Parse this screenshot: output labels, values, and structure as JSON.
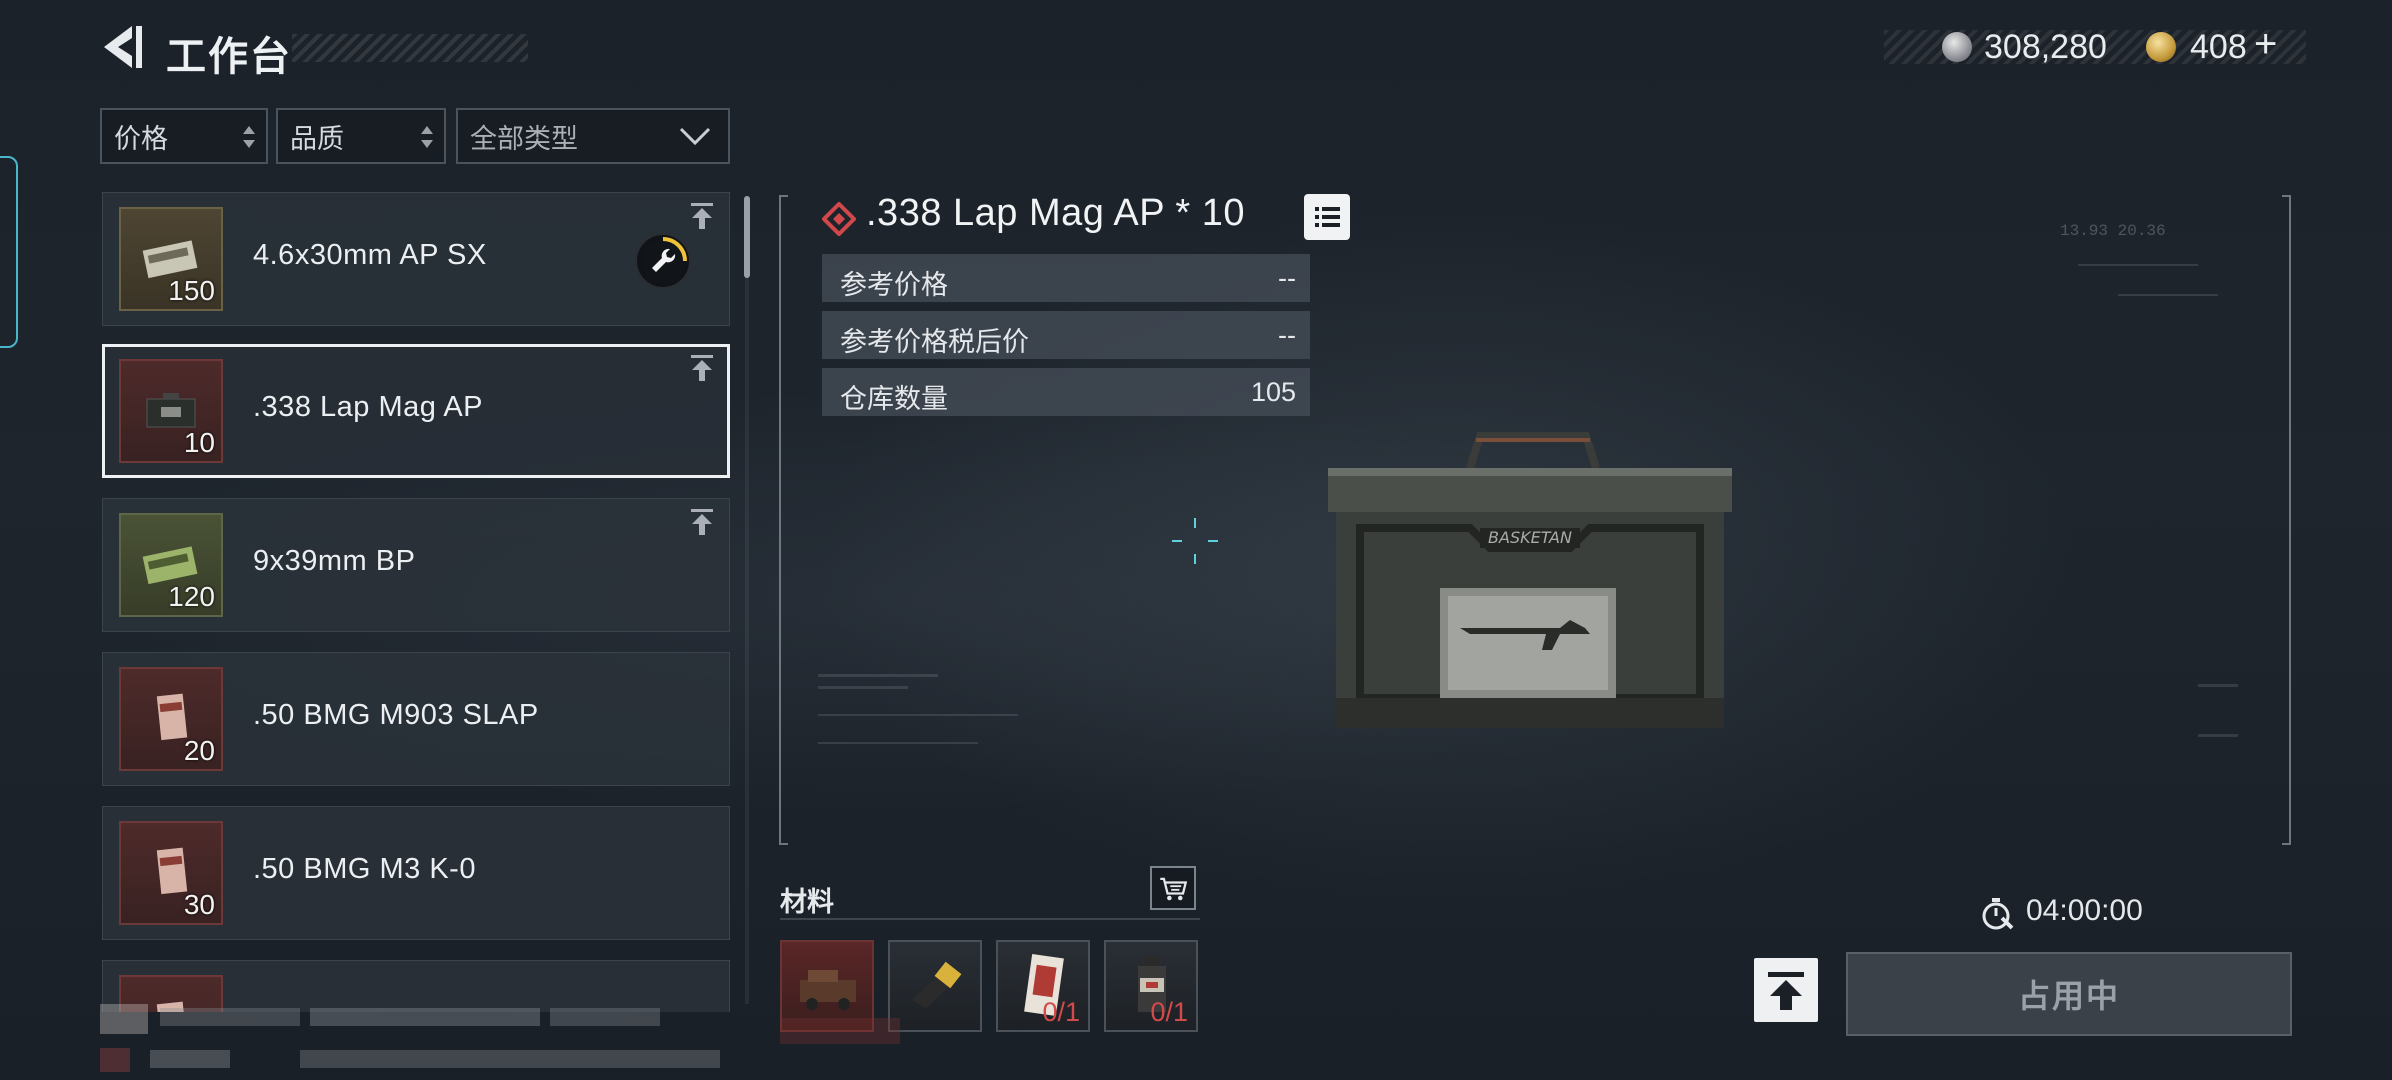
{
  "header": {
    "title": "工作台"
  },
  "currency": {
    "silver": "308,280",
    "gold": "408",
    "plus": "+",
    "silver_icon": "silver-coin-icon",
    "gold_icon": "gold-coin-icon"
  },
  "filters": {
    "price": "价格",
    "quality": "品质",
    "type": "全部类型"
  },
  "items": [
    {
      "name": "4.6x30mm AP SX",
      "count": "150",
      "rarity": "gold",
      "crafting": true
    },
    {
      "name": ".338 Lap Mag AP",
      "count": "10",
      "rarity": "red",
      "selected": true
    },
    {
      "name": "9x39mm BP",
      "count": "120",
      "rarity": "green"
    },
    {
      "name": ".50 BMG M903 SLAP",
      "count": "20",
      "rarity": "red"
    },
    {
      "name": ".50 BMG M3 K-0",
      "count": "30",
      "rarity": "red"
    }
  ],
  "detail": {
    "title": ".338 Lap Mag AP * 10",
    "stats": [
      {
        "label": "参考价格",
        "value": "--"
      },
      {
        "label": "参考价格税后价",
        "value": "--"
      },
      {
        "label": "仓库数量",
        "value": "105"
      }
    ],
    "hud_readout": "13.93   20.36",
    "box_label": "BASKETAN"
  },
  "materials": {
    "title": "材料",
    "items": [
      {
        "icon": "material-part-icon",
        "count": ""
      },
      {
        "icon": "material-tool-icon",
        "count": ""
      },
      {
        "icon": "material-card-icon",
        "count": "0/1"
      },
      {
        "icon": "material-bottle-icon",
        "count": "0/1"
      }
    ]
  },
  "craft": {
    "timer": "04:00:00",
    "status_button": "占用中"
  },
  "colors": {
    "accent_cyan": "#49b7c9",
    "rarity_red": "#6d3838",
    "rarity_gold": "#6b6246",
    "rarity_green": "#5d6646",
    "missing_red": "#d24a4a"
  }
}
